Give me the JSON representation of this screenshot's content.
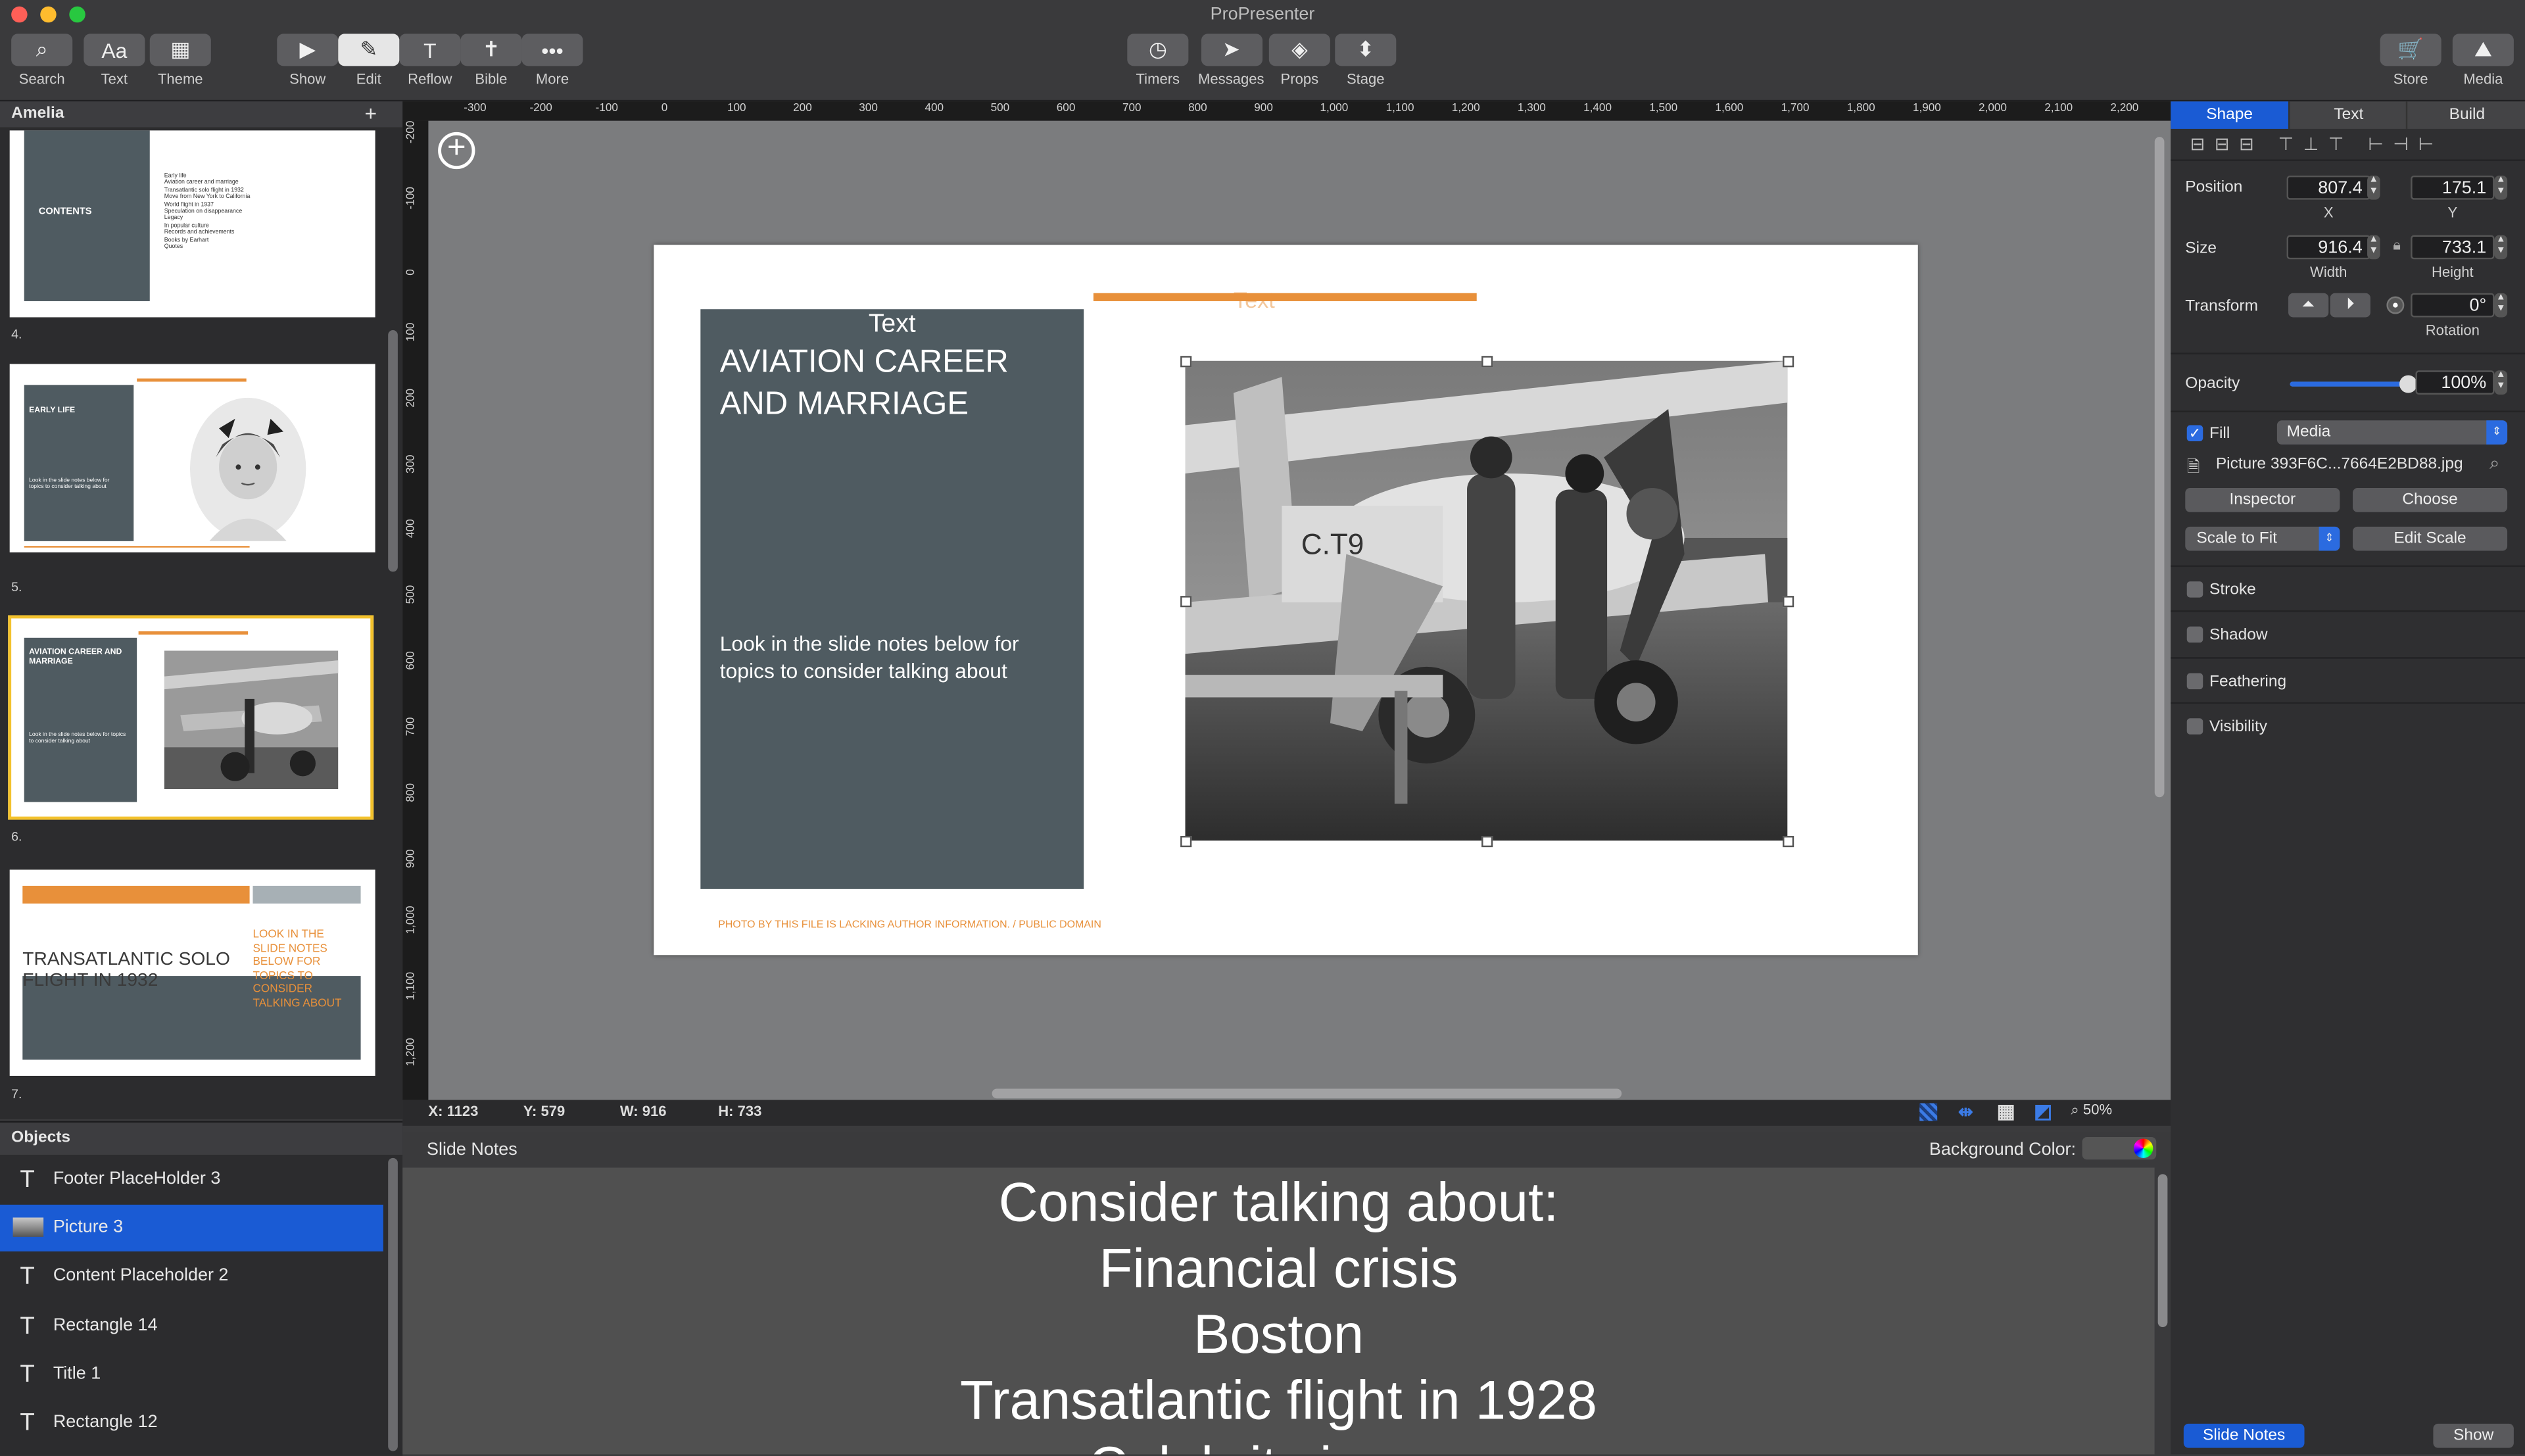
{
  "window": {
    "title": "ProPresenter"
  },
  "toolbar": {
    "left": [
      {
        "label": "Search",
        "icon": "search-icon",
        "glyph": "⌕"
      },
      {
        "label": "Text",
        "icon": "text-icon",
        "glyph": "Aa"
      },
      {
        "label": "Theme",
        "icon": "theme-icon",
        "glyph": "▦"
      }
    ],
    "mode": [
      {
        "label": "Show",
        "icon": "play-icon",
        "glyph": "▶"
      },
      {
        "label": "Edit",
        "icon": "pencil-icon",
        "glyph": "✎"
      },
      {
        "label": "Reflow",
        "icon": "reflow-icon",
        "glyph": "T"
      },
      {
        "label": "Bible",
        "icon": "bible-icon",
        "glyph": "✝"
      },
      {
        "label": "More",
        "icon": "more-icon",
        "glyph": "•••"
      }
    ],
    "center": [
      {
        "label": "Timers",
        "icon": "timer-icon",
        "glyph": "◷"
      },
      {
        "label": "Messages",
        "icon": "send-icon",
        "glyph": "➤"
      },
      {
        "label": "Props",
        "icon": "layers-icon",
        "glyph": "◈"
      },
      {
        "label": "Stage",
        "icon": "stage-icon",
        "glyph": "⬍"
      }
    ],
    "right": [
      {
        "label": "Store",
        "icon": "cart-icon",
        "glyph": "🛒"
      },
      {
        "label": "Media",
        "icon": "media-icon",
        "glyph": "⛰"
      }
    ]
  },
  "library": {
    "title": "Amelia",
    "add": "+",
    "slides": [
      {
        "num": "4.",
        "title": "CONTENTS",
        "items": [
          "Early life",
          "Aviation career and marriage",
          "Transatlantic solo flight in 1932",
          "Move from New York to California",
          "World flight in 1937",
          "Speculation on disappearance",
          "Legacy",
          "In popular culture",
          "Records and achievements",
          "Books by Earhart",
          "Quotes"
        ]
      },
      {
        "num": "5.",
        "title": "EARLY LIFE",
        "body": "Look in the slide notes below for topics to consider talking about"
      },
      {
        "num": "6.",
        "title": "AVIATION CAREER AND MARRIAGE",
        "body": "Look in the slide notes below for topics to consider talking about"
      },
      {
        "num": "7.",
        "title": "TRANSATLANTIC SOLO FLIGHT IN 1932",
        "body": "LOOK IN THE SLIDE NOTES BELOW FOR TOPICS TO CONSIDER TALKING ABOUT"
      }
    ]
  },
  "objects": {
    "title": "Objects",
    "items": [
      {
        "label": "Footer PlaceHolder 3",
        "icon": "text-object-icon"
      },
      {
        "label": "Picture 3",
        "icon": "image-object-icon",
        "selected": true
      },
      {
        "label": "Content Placeholder 2",
        "icon": "text-object-icon"
      },
      {
        "label": "Rectangle 14",
        "icon": "text-object-icon"
      },
      {
        "label": "Title 1",
        "icon": "text-object-icon"
      },
      {
        "label": "Rectangle 12",
        "icon": "text-object-icon"
      }
    ]
  },
  "ruler": {
    "h": [
      "-300",
      "-200",
      "-100",
      "0",
      "100",
      "200",
      "300",
      "400",
      "500",
      "600",
      "700",
      "800",
      "900",
      "1,000",
      "1,100",
      "1,200",
      "1,300",
      "1,400",
      "1,500",
      "1,600",
      "1,700",
      "1,800",
      "1,900",
      "2,000",
      "2,100",
      "2,200"
    ],
    "v": [
      "-200",
      "-100",
      "0",
      "100",
      "200",
      "300",
      "400",
      "500",
      "600",
      "700",
      "800",
      "900",
      "1,000",
      "1,100",
      "1,200"
    ]
  },
  "slide": {
    "box_label": "Text",
    "title": "AVIATION CAREER AND MARRIAGE",
    "body": "Look in the slide notes below for topics to consider talking about",
    "top_label": "Text",
    "footer": "PHOTO BY THIS FILE IS LACKING AUTHOR INFORMATION. / PUBLIC DOMAIN",
    "plane_label": "C.T9"
  },
  "status": {
    "x": "X: 1123",
    "y": "Y: 579",
    "w": "W: 916",
    "h": "H: 733",
    "zoom": "50%"
  },
  "notes": {
    "title": "Slide Notes",
    "bg_label": "Background Color:",
    "lines": [
      "Consider talking about:",
      "Financial crisis",
      "Boston",
      "Transatlantic flight in 1928",
      "Celebrity image"
    ]
  },
  "inspector": {
    "tabs": [
      "Shape",
      "Text",
      "Build"
    ],
    "position": {
      "label": "Position",
      "x": "807.4",
      "y": "175.1",
      "x_sub": "X",
      "y_sub": "Y"
    },
    "size": {
      "label": "Size",
      "w": "916.4",
      "h": "733.1",
      "w_sub": "Width",
      "h_sub": "Height"
    },
    "transform": {
      "label": "Transform",
      "rotation": "0°",
      "rot_sub": "Rotation"
    },
    "opacity": {
      "label": "Opacity",
      "value": "100%",
      "level": 1.0
    },
    "fill": {
      "label": "Fill",
      "type": "Media",
      "file": "Picture 393F6C...7664E2BD88.jpg",
      "inspector": "Inspector",
      "choose": "Choose",
      "scale": "Scale to Fit",
      "edit_scale": "Edit Scale"
    },
    "stroke": "Stroke",
    "shadow": "Shadow",
    "feathering": "Feathering",
    "visibility": "Visibility",
    "bottom": {
      "notes": "Slide Notes",
      "show": "Show"
    }
  },
  "colors": {
    "accent": "#1a5bd4",
    "slide_box": "#4f5b61",
    "orange": "#e8903a",
    "select_yellow": "#f3c22d"
  }
}
